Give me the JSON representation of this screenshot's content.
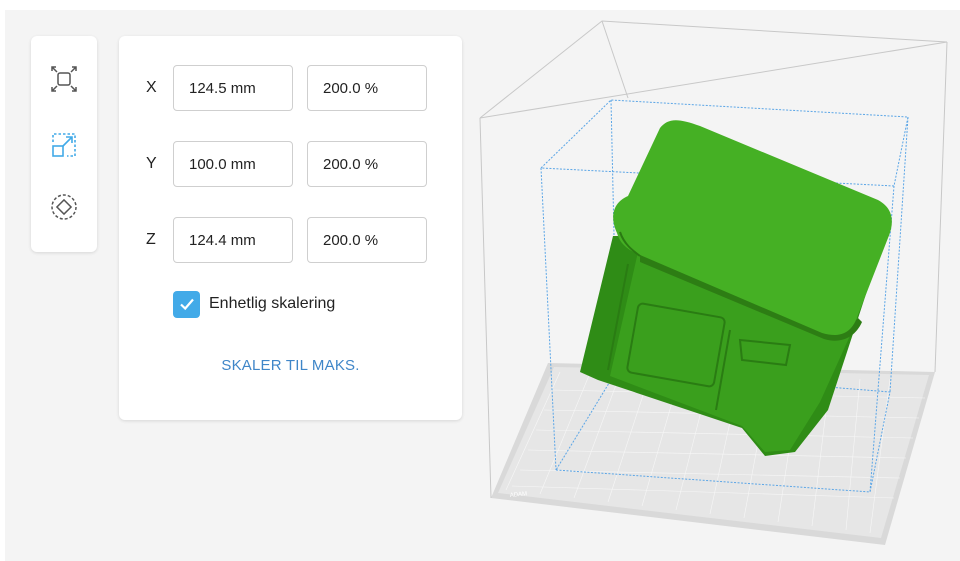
{
  "tools": [
    {
      "name": "move-icon",
      "active": false
    },
    {
      "name": "scale-icon",
      "active": true
    },
    {
      "name": "rotate-icon",
      "active": false
    }
  ],
  "scale_panel": {
    "rows": [
      {
        "axis": "X",
        "mm": "124.5 mm",
        "percent": "200.0 %"
      },
      {
        "axis": "Y",
        "mm": "100.0 mm",
        "percent": "200.0 %"
      },
      {
        "axis": "Z",
        "mm": "124.4 mm",
        "percent": "200.0 %"
      }
    ],
    "uniform_scaling_label": "Enhetlig skalering",
    "uniform_scaling_checked": true,
    "scale_to_max_label": "SKALER TIL MAKS."
  },
  "colors": {
    "accent": "#42aae8",
    "link": "#3f86c8",
    "model": "#3aa01f",
    "bounding_box": "#5aa5e6"
  }
}
